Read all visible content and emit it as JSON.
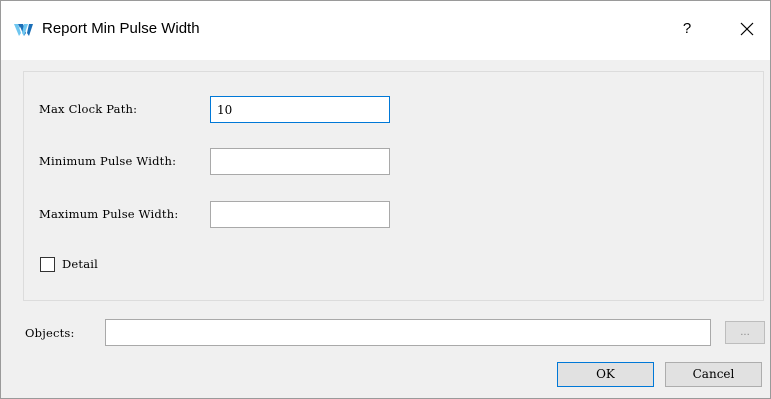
{
  "window": {
    "title": "Report Min Pulse Width",
    "help_label": "?"
  },
  "form": {
    "max_clock_path": {
      "label": "Max Clock Path:",
      "value": "10"
    },
    "min_pulse_width": {
      "label": "Minimum Pulse Width:",
      "value": ""
    },
    "max_pulse_width": {
      "label": "Maximum Pulse Width:",
      "value": ""
    },
    "detail": {
      "label": "Detail",
      "checked": false
    }
  },
  "objects": {
    "label": "Objects:",
    "value": "",
    "browse_label": "..."
  },
  "buttons": {
    "ok": "OK",
    "cancel": "Cancel"
  },
  "colors": {
    "accent": "#0078d7",
    "window_bg": "#f0f0f0",
    "titlebar_bg": "#ffffff",
    "icon_light": "#6ec6f0",
    "icon_dark": "#1a6fb8"
  },
  "icons": {
    "app": "gowin-logo-icon",
    "close": "close-icon"
  }
}
